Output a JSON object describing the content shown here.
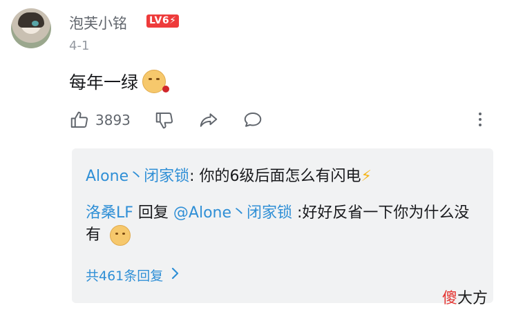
{
  "comment": {
    "username": "泡芙小铭",
    "level_badge": "LV6⚡",
    "date": "4-1",
    "text": "每年一绿",
    "like_count": "3893"
  },
  "replies": [
    {
      "user": "Alone丶闭家锁",
      "sep": ": ",
      "text": "你的6级后面怎么有闪电",
      "suffix": "⚡"
    },
    {
      "user": "洛桑LF",
      "reply_word": " 回复 ",
      "mention": "@Alone丶闭家锁",
      "text": " :好好反省一下你为什么没有"
    }
  ],
  "total_replies": "共461条回复",
  "watermark": {
    "part1": "傻",
    "part2": "大方"
  },
  "colors": {
    "link": "#2f8fd6",
    "level": "#ee3b3b",
    "muted": "#9499a0"
  }
}
